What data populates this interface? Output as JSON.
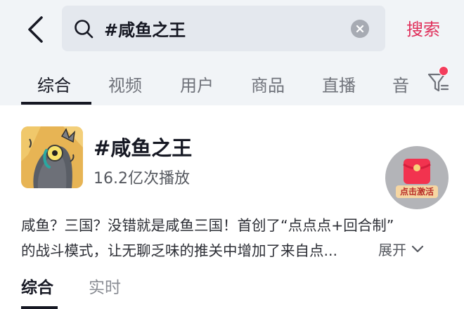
{
  "header": {
    "search": {
      "query": "#咸鱼之王",
      "submit_label": "搜索"
    },
    "tabs": [
      {
        "label": "综合",
        "active": true
      },
      {
        "label": "视频",
        "active": false
      },
      {
        "label": "用户",
        "active": false
      },
      {
        "label": "商品",
        "active": false
      },
      {
        "label": "直播",
        "active": false
      },
      {
        "label": "音",
        "active": false
      }
    ]
  },
  "topic": {
    "title": "#咸鱼之王",
    "play_count": "16.2亿次播放",
    "description_lines": [
      "咸鱼？三国？没错就是咸鱼三国！首创了“点点点+回合制”",
      "的战斗模式，让无聊乏味的推关中增加了来自点..."
    ],
    "expand_label": "展开"
  },
  "red_packet": {
    "label": "点击激活"
  },
  "sub_tabs": [
    {
      "label": "综合",
      "active": true
    },
    {
      "label": "实时",
      "active": false
    }
  ],
  "colors": {
    "accent": "#e02e5a",
    "notification_dot": "#f33d5c",
    "header_bg": "#f1f4f7",
    "search_bg": "#e4e8ee"
  }
}
